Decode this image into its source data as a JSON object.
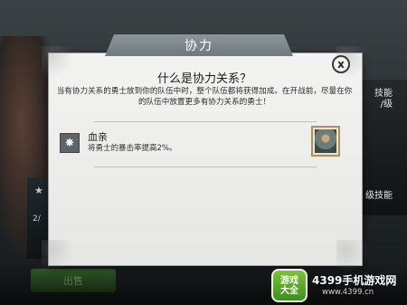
{
  "background": {
    "right_skill_label_lines": [
      "技能",
      "/级"
    ],
    "right_skill_label_2": "级技能",
    "left_fraction": "2/",
    "sell_button_label": "出售"
  },
  "dialog": {
    "title": "协力",
    "heading": "什么是协力关系？",
    "description_line1": "当有协力关系的勇士放到你的队伍中时，整个队伍都将获得加成。在开战前，尽量在你",
    "description_line2": "的队伍中放置更多有协力关系的勇士！",
    "close_glyph": "x",
    "synergy": {
      "name": "血亲",
      "effect": "将勇士的暴击率提高2%。",
      "icon": "burst-star-icon",
      "portrait": "hero-portrait"
    }
  },
  "watermark": {
    "badge_line1": "游戏",
    "badge_line2": "大全",
    "site_name": "4399手机游戏网",
    "site_url": "www.4399.cn"
  },
  "colors": {
    "banner": "#7d878b",
    "dialog_bg": "#eeeeed",
    "sell_green": "#3f7a2e",
    "watermark_green": "#5faa2c"
  }
}
